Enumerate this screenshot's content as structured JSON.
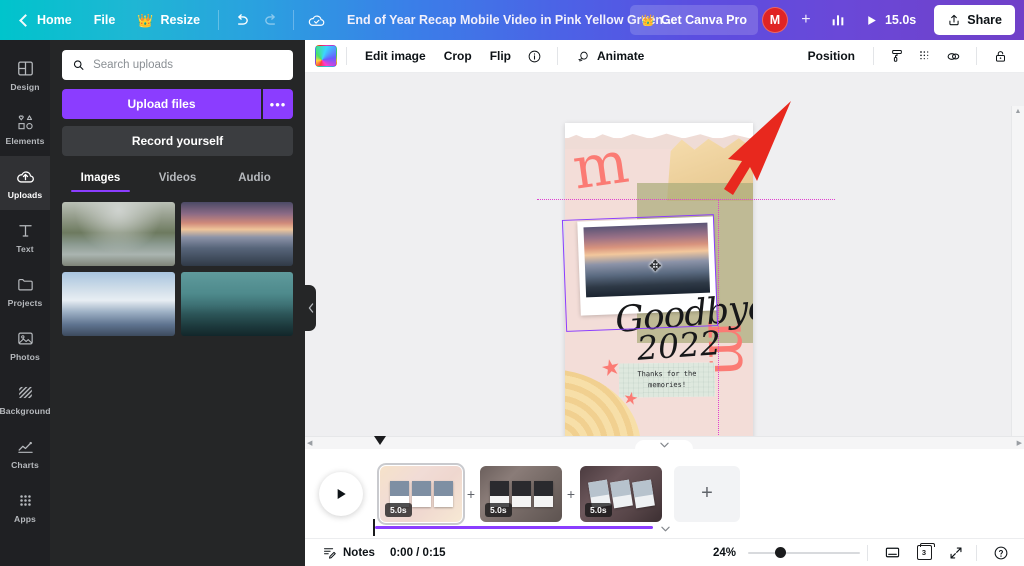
{
  "topbar": {
    "back_label": "Home",
    "file_label": "File",
    "resize_label": "Resize",
    "resize_icon": "crown-icon",
    "undo_icon": "undo-icon",
    "redo_icon": "redo-icon",
    "saved_icon": "cloud-check-icon",
    "doc_title": "End of Year Recap Mobile Video in Pink Yellow Green Refine…",
    "pro_label": "Get Canva Pro",
    "pro_icon": "crown-icon",
    "avatar_initial": "M",
    "invite_label": "+",
    "insights_icon": "bar-chart-icon",
    "duration_label": "15.0s",
    "play_icon": "play-icon",
    "share_label": "Share",
    "share_icon": "share-upload-icon",
    "accent_teal": "#00c4cc",
    "accent_purple": "#7040c8"
  },
  "rail": {
    "items": [
      {
        "label": "Design",
        "icon": "layout-icon",
        "active": false
      },
      {
        "label": "Elements",
        "icon": "shapes-icon",
        "active": false
      },
      {
        "label": "Uploads",
        "icon": "cloud-upload-icon",
        "active": true
      },
      {
        "label": "Text",
        "icon": "text-t-icon",
        "active": false
      },
      {
        "label": "Projects",
        "icon": "folder-icon",
        "active": false
      },
      {
        "label": "Photos",
        "icon": "photo-icon",
        "active": false
      },
      {
        "label": "Background",
        "icon": "hatch-pattern-icon",
        "active": false
      },
      {
        "label": "Charts",
        "icon": "line-chart-icon",
        "active": false
      },
      {
        "label": "Apps",
        "icon": "grid-dots-icon",
        "active": false
      }
    ]
  },
  "uploads_panel": {
    "search_placeholder": "Search uploads",
    "search_value": "",
    "search_icon": "search-icon",
    "upload_button": "Upload files",
    "upload_more_icon": "ellipsis-icon",
    "record_button": "Record yourself",
    "tabs": [
      {
        "label": "Images",
        "active": true
      },
      {
        "label": "Videos",
        "active": false
      },
      {
        "label": "Audio",
        "active": false
      }
    ],
    "thumbnails": [
      {
        "name": "misty-river-forest"
      },
      {
        "name": "sunset-mountain-lake"
      },
      {
        "name": "snow-capped-peaks"
      },
      {
        "name": "teal-twilight-mountains"
      }
    ],
    "collapse_icon": "chevron-left-icon",
    "accent_color": "#8b3dff"
  },
  "ctx_toolbar": {
    "color_chip_name": "image-color-swatch",
    "edit_image": "Edit image",
    "crop": "Crop",
    "flip": "Flip",
    "info_icon": "info-circle-icon",
    "animate": "Animate",
    "animate_icon": "animate-icon",
    "position": "Position",
    "transparency_icon": "transparency-icon",
    "paint_icon": "paint-roller-icon",
    "duplicate_icon": "duplicate-link-icon",
    "lock_icon": "lock-icon"
  },
  "canvas": {
    "design_text": {
      "goodbye": "Goodbye,",
      "year": "2022",
      "note_line1": "Thanks for the",
      "note_line2": "memories!"
    },
    "selection_color": "#8b3dff",
    "guide_color": "#e040d0",
    "annotation_arrow": "red-arrow-annotation",
    "move_cursor_icon": "move-cursor-icon",
    "scroll_up_icon": "triangle-up-icon",
    "scroll_down_icon": "triangle-down-icon",
    "scroll_left_icon": "triangle-left-icon",
    "scroll_right_icon": "triangle-right-icon"
  },
  "timeline": {
    "play_icon": "play-icon",
    "collapse_icon": "chevron-down-icon",
    "expand_icon": "chevron-down-icon",
    "add_between_label": "+",
    "add_page_label": "+",
    "scenes": [
      {
        "duration": "5.0s",
        "selected": true,
        "name": "scene-1"
      },
      {
        "duration": "5.0s",
        "selected": false,
        "name": "scene-2"
      },
      {
        "duration": "5.0s",
        "selected": false,
        "name": "scene-3"
      }
    ]
  },
  "statusbar": {
    "notes_label": "Notes",
    "notes_icon": "notes-icon",
    "time_display": "0:00 / 0:15",
    "zoom_level": "24%",
    "presenter_icon": "presenter-view-icon",
    "pages_count": "3",
    "pages_icon": "pages-icon",
    "fullscreen_icon": "expand-arrows-icon",
    "help_icon": "help-circle-icon"
  }
}
